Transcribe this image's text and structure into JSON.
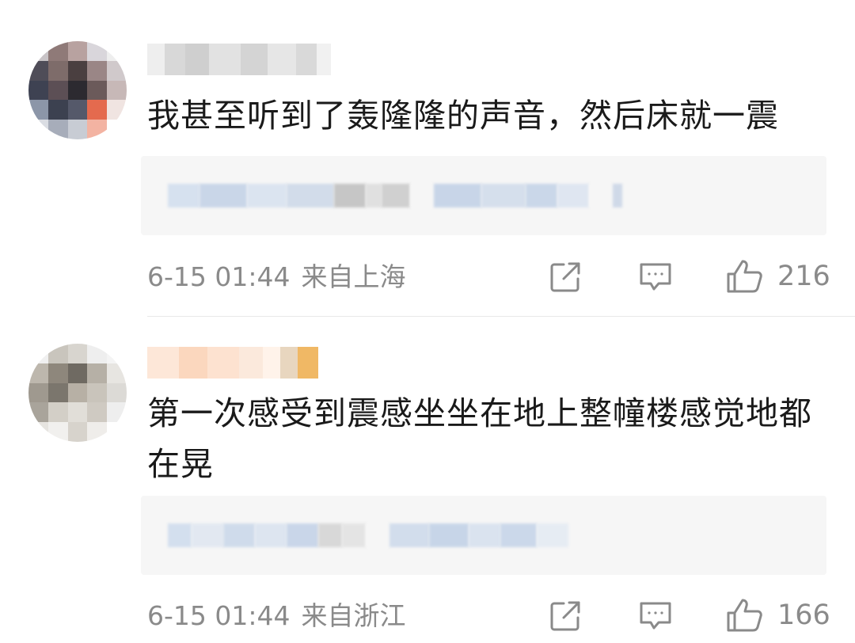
{
  "comments": [
    {
      "text": "我甚至听到了轰隆隆的声音，然后床就一震",
      "date": "6-15 01:44",
      "location": "来自上海",
      "likes": "216"
    },
    {
      "text": "第一次感受到震感坐坐在地上整幢楼感觉地都在晃",
      "date": "6-15 01:44",
      "location": "来自浙江",
      "likes": "166"
    }
  ]
}
